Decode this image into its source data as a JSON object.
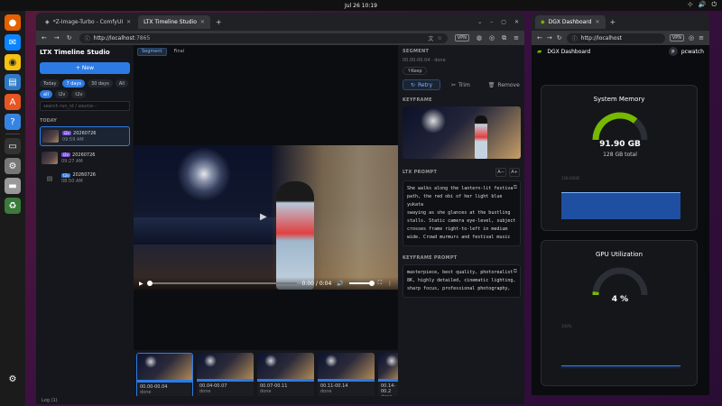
{
  "system": {
    "datetime": "Jul 26  10:19"
  },
  "dock": {
    "apps": [
      "firefox-icon",
      "thunderbird-icon",
      "rhythmbox-icon",
      "writer-icon",
      "appcenter-icon",
      "help-icon",
      "terminal-icon",
      "settings-icon",
      "disk-icon",
      "trash-icon",
      "apps-grid-icon"
    ]
  },
  "browser_left": {
    "tabs": [
      {
        "label": "*Z-Image-Turbo - ComfyUI"
      },
      {
        "label": "LTX Timeline Studio"
      }
    ],
    "url_host": "http://localhost",
    "url_port": ":7865",
    "vpn": "VPN"
  },
  "ltx": {
    "brand": "LTX Timeline Studio",
    "new_button": "+ New",
    "filters": [
      "Today",
      "7 days",
      "30 days",
      "All"
    ],
    "kind_filters": [
      "all",
      "i2v",
      "t2v"
    ],
    "search_placeholder": "search run_id / source···",
    "group_label": "TODAY",
    "runs": [
      {
        "badge": "i2v",
        "id": "20260726",
        "time": "09:59 AM"
      },
      {
        "badge": "i2v",
        "id": "20260726",
        "time": "09:27 AM"
      },
      {
        "badge": "t2v",
        "id": "20260726",
        "time": "08:50 AM"
      }
    ],
    "view_tabs": [
      "Segment",
      "Final"
    ],
    "player": {
      "time": "0:00 / 0:04"
    },
    "clips": [
      {
        "range": "00.00-00.04",
        "status": "done"
      },
      {
        "range": "00.04-00.07",
        "status": "done"
      },
      {
        "range": "00.07-00.11",
        "status": "done"
      },
      {
        "range": "00.11-00.14",
        "status": "done"
      },
      {
        "range": "00.14-00.2",
        "status": "done"
      }
    ],
    "right": {
      "segment_title": "SEGMENT",
      "segment_meta": "00.00-00.04 · done",
      "keep": "Keep",
      "retry": "Retry",
      "trim": "Trim",
      "remove": "Remove",
      "keyframe_title": "KEYFRAME",
      "ltx_prompt_title": "LTX PROMPT",
      "font_down": "A−",
      "font_up": "A+",
      "ltx_prompt": [
        "She walks along the lantern-lit festiva",
        "path, the red obi of her light blue yukata",
        "swaying as she glances at the bustling",
        "stalls. Static camera eye-level, subject",
        "crosses frame right-to-left in medium",
        "wide. Crowd murmurs and festival music"
      ],
      "kf_prompt_title": "KEYFRAME PROMPT",
      "kf_prompt": [
        "masterpiece, best quality, photorealist",
        "8K, highly detailed, cinematic lighting,",
        "sharp focus, professional photography,"
      ]
    },
    "log": "Log (1)"
  },
  "browser_right": {
    "tab": "DGX Dashboard",
    "url": "http://localhost",
    "vpn": "VPN"
  },
  "dgx": {
    "logo": "DGX Dashboard",
    "avatar": "p",
    "user": "pcwatch",
    "memory": {
      "title": "System Memory",
      "value": "91.90 GB",
      "sub": "128 GB total",
      "fraction": 0.718,
      "axis_top": "128.00GB"
    },
    "gpu": {
      "title": "GPU Utilization",
      "value": "4 %",
      "fraction": 0.04,
      "axis_top": "100%"
    }
  }
}
